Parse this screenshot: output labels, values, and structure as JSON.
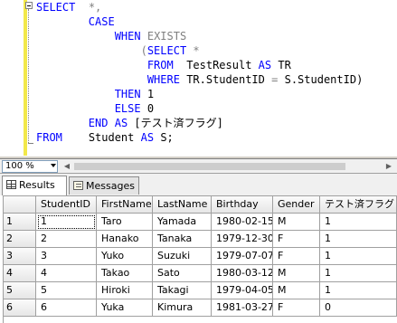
{
  "editor": {
    "keywords": {
      "select": "SELECT",
      "case": "CASE",
      "when": "WHEN",
      "exists": "EXISTS",
      "select_inner": "SELECT",
      "from_inner": "FROM",
      "as_tr": "AS",
      "where": "WHERE",
      "eq": "=",
      "then": "THEN",
      "else": "ELSE",
      "end": "END",
      "as_alias": "AS",
      "from_outer": "FROM",
      "as_s": "AS"
    },
    "lines": {
      "l1_star": "*,",
      "l4_open": "(",
      "l4_star": "*",
      "l5_table": "TestResult",
      "l5_alias": "TR",
      "l6_left": "TR.StudentID",
      "l6_right": "S.StudentID)",
      "l7_value": "1",
      "l8_value": "0",
      "l9_alias": "[テスト済フラグ]",
      "l10_table": "Student",
      "l10_alias": "S;"
    }
  },
  "zoom": {
    "value": "100 %"
  },
  "tabs": [
    {
      "label": "Results",
      "icon": "grid-icon"
    },
    {
      "label": "Messages",
      "icon": "messages-icon"
    }
  ],
  "results": {
    "columns": [
      "StudentID",
      "FirstName",
      "LastName",
      "Birthday",
      "Gender",
      "テスト済フラグ"
    ],
    "rows": [
      {
        "num": "1",
        "cells": [
          "1",
          "Taro",
          "Yamada",
          "1980-02-15",
          "M",
          "1"
        ]
      },
      {
        "num": "2",
        "cells": [
          "2",
          "Hanako",
          "Tanaka",
          "1979-12-30",
          "F",
          "1"
        ]
      },
      {
        "num": "3",
        "cells": [
          "3",
          "Yuko",
          "Suzuki",
          "1979-07-07",
          "F",
          "1"
        ]
      },
      {
        "num": "4",
        "cells": [
          "4",
          "Takao",
          "Sato",
          "1980-03-12",
          "M",
          "1"
        ]
      },
      {
        "num": "5",
        "cells": [
          "5",
          "Hiroki",
          "Takagi",
          "1979-04-05",
          "M",
          "1"
        ]
      },
      {
        "num": "6",
        "cells": [
          "6",
          "Yuka",
          "Kimura",
          "1981-03-27",
          "F",
          "0"
        ]
      }
    ]
  }
}
